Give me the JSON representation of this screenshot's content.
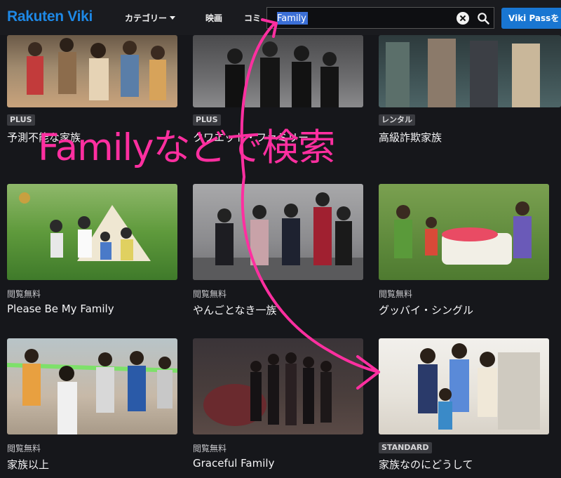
{
  "header": {
    "logo": "Rakuten Viki",
    "nav": [
      "カテゴリー",
      "映画",
      "コミ"
    ],
    "search": {
      "value": "Family"
    },
    "viki_pass_label": "Viki Passを"
  },
  "annotation": {
    "text": "Familyなどで検索",
    "color": "#ff2fa0"
  },
  "cards": [
    {
      "badge": "PLUS",
      "meta": "",
      "title": "予測不能な家族"
    },
    {
      "badge": "PLUS",
      "meta": "",
      "title": "クワエット・ファミリー"
    },
    {
      "badge": "レンタル",
      "meta": "",
      "title": "高級詐欺家族"
    },
    {
      "badge": "",
      "meta": "閲覧無料",
      "title": "Please Be My Family"
    },
    {
      "badge": "",
      "meta": "閲覧無料",
      "title": "やんごとなき一族"
    },
    {
      "badge": "",
      "meta": "閲覧無料",
      "title": "グッバイ・シングル"
    },
    {
      "badge": "",
      "meta": "閲覧無料",
      "title": "家族以上"
    },
    {
      "badge": "",
      "meta": "閲覧無料",
      "title": "Graceful Family"
    },
    {
      "badge": "STANDARD",
      "meta": "",
      "title": "家族なのにどうして"
    }
  ],
  "colors": {
    "accent": "#1976d2",
    "annotation": "#ff2fa0",
    "background": "#16171b"
  }
}
